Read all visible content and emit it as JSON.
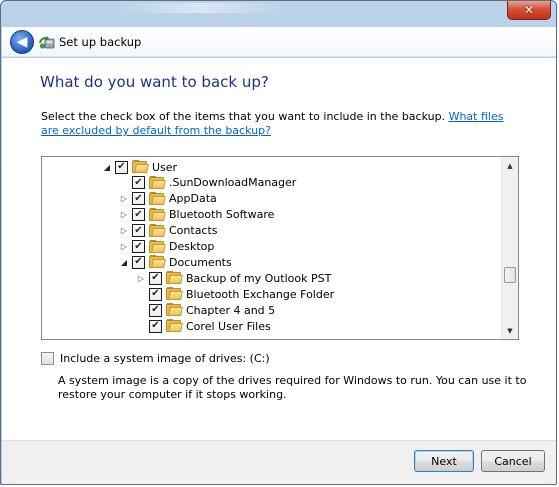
{
  "window": {
    "title": "Set up backup",
    "close_glyph": "✕"
  },
  "nav": {
    "back_glyph": "◀"
  },
  "main": {
    "heading": "What do you want to back up?",
    "instruction_text": "Select the check box of the items that you want to include in the backup.",
    "instruction_link": "What files are excluded by default from the backup?"
  },
  "tree": {
    "items": [
      {
        "label": "User",
        "level": 0,
        "expander": "open",
        "checked": true
      },
      {
        "label": ".SunDownloadManager",
        "level": 1,
        "expander": "none",
        "checked": true
      },
      {
        "label": "AppData",
        "level": 1,
        "expander": "closed",
        "checked": true
      },
      {
        "label": "Bluetooth Software",
        "level": 1,
        "expander": "closed",
        "checked": true
      },
      {
        "label": "Contacts",
        "level": 1,
        "expander": "closed",
        "checked": true
      },
      {
        "label": "Desktop",
        "level": 1,
        "expander": "closed",
        "checked": true
      },
      {
        "label": "Documents",
        "level": 1,
        "expander": "open",
        "checked": true
      },
      {
        "label": "Backup of my Outlook PST",
        "level": 2,
        "expander": "closed",
        "checked": true
      },
      {
        "label": "Bluetooth Exchange Folder",
        "level": 2,
        "expander": "none",
        "checked": true
      },
      {
        "label": "Chapter 4 and 5",
        "level": 2,
        "expander": "none",
        "checked": true
      },
      {
        "label": "Corel User Files",
        "level": 2,
        "expander": "none",
        "checked": true
      }
    ],
    "check_glyph": "✔",
    "expander_open_glyph": "◢",
    "expander_closed_glyph": "▷"
  },
  "system_image": {
    "label": "Include a system image of drives: (C:)",
    "checked": false,
    "description": "A system image is a copy of the drives required for Windows to run. You can use it to restore your computer if it stops working."
  },
  "buttons": {
    "next": "Next",
    "cancel": "Cancel"
  },
  "colors": {
    "heading": "#1e3287",
    "link": "#0066cc",
    "close_button": "#d24b32"
  }
}
